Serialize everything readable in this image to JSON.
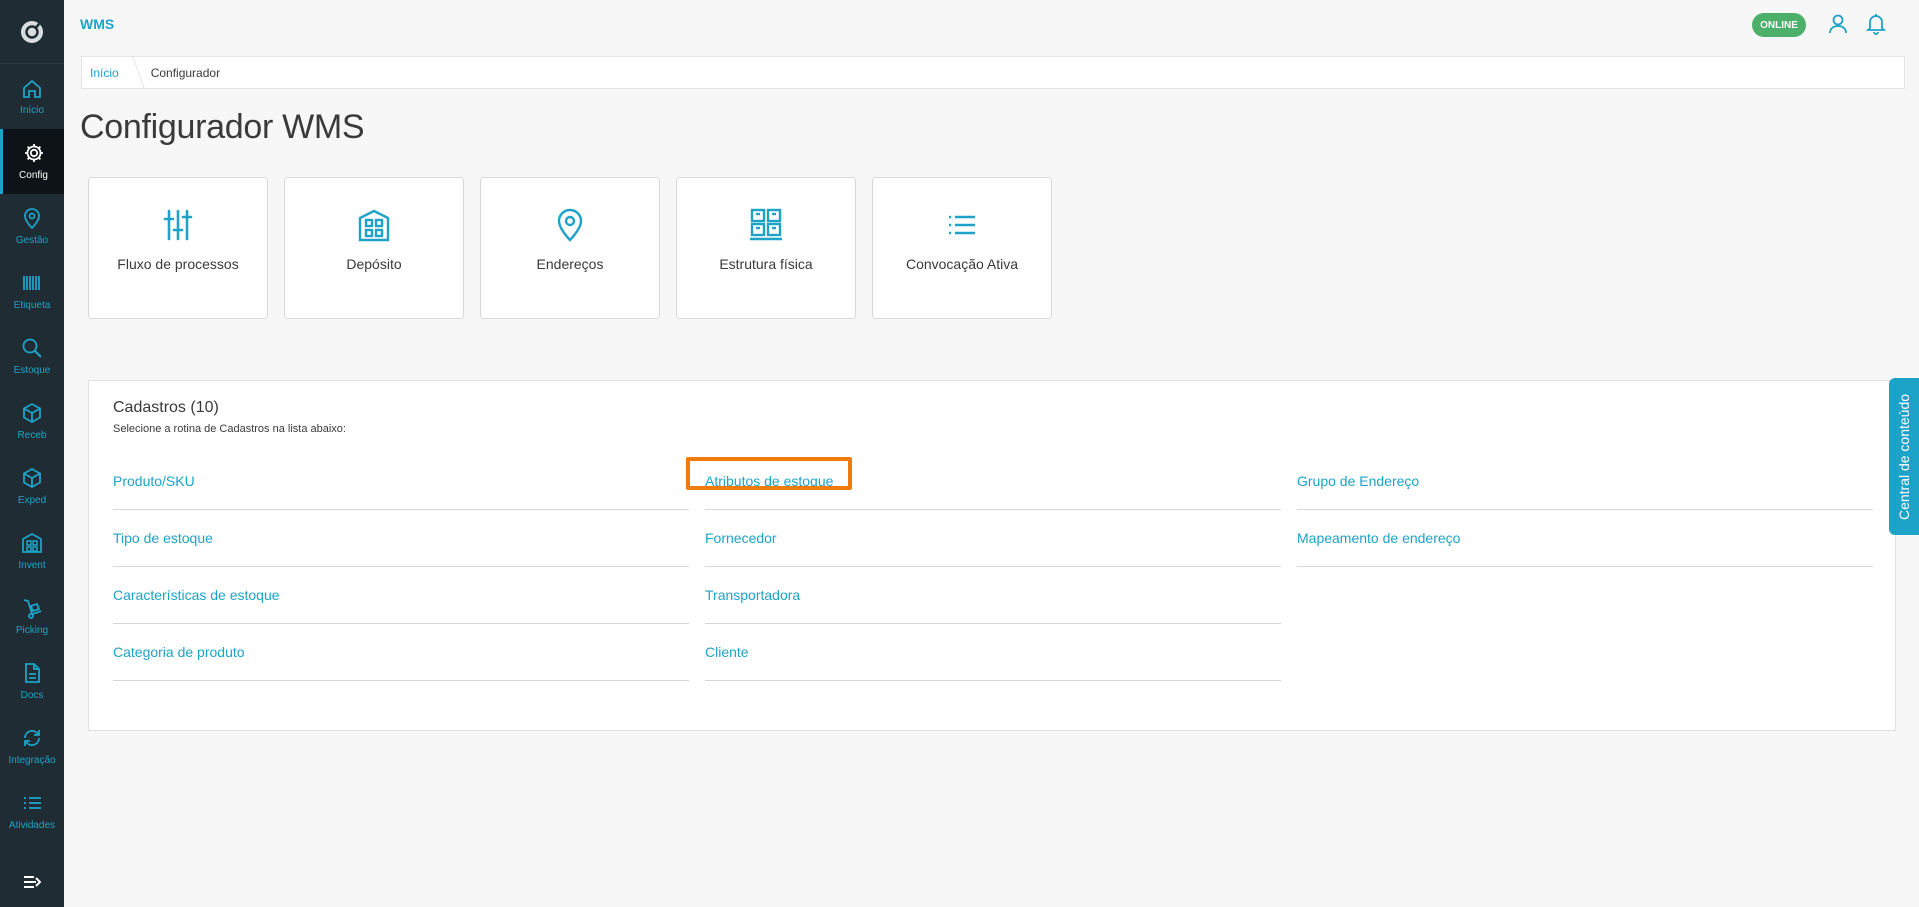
{
  "app": {
    "title": "WMS",
    "status": "ONLINE"
  },
  "colors": {
    "accent": "#1ea3c8",
    "sidebar": "#1f2c33",
    "online": "#4caf6a",
    "highlight": "#f07b0a"
  },
  "sidebar": {
    "items": [
      {
        "label": "Início",
        "icon": "home-icon"
      },
      {
        "label": "Config",
        "icon": "gear-icon"
      },
      {
        "label": "Gestão",
        "icon": "map-pin-icon"
      },
      {
        "label": "Etiqueta",
        "icon": "barcode-icon"
      },
      {
        "label": "Estoque",
        "icon": "search-icon"
      },
      {
        "label": "Receb",
        "icon": "box-icon"
      },
      {
        "label": "Exped",
        "icon": "box-icon"
      },
      {
        "label": "Invent",
        "icon": "building-icon"
      },
      {
        "label": "Picking",
        "icon": "hand-truck-icon"
      },
      {
        "label": "Docs",
        "icon": "document-icon"
      },
      {
        "label": "Integração",
        "icon": "sync-icon"
      },
      {
        "label": "Atividades",
        "icon": "list-icon"
      }
    ]
  },
  "breadcrumb": {
    "home": "Início",
    "current": "Configurador"
  },
  "page": {
    "title": "Configurador WMS"
  },
  "cards": [
    {
      "label": "Fluxo de processos",
      "icon": "sliders-icon"
    },
    {
      "label": "Depósito",
      "icon": "building-icon"
    },
    {
      "label": "Endereços",
      "icon": "map-pin-icon"
    },
    {
      "label": "Estrutura física",
      "icon": "pallet-icon"
    },
    {
      "label": "Convocação Ativa",
      "icon": "list-icon"
    }
  ],
  "cadastros": {
    "title": "Cadastros (10)",
    "subtitle": "Selecione a rotina de Cadastros na lista abaixo:",
    "columns": [
      [
        "Produto/SKU",
        "Tipo de estoque",
        "Características de estoque",
        "Categoria de produto"
      ],
      [
        "Atributos de estoque",
        "Fornecedor",
        "Transportadora",
        "Cliente"
      ],
      [
        "Grupo de Endereço",
        "Mapeamento de endereço"
      ]
    ],
    "highlighted": "Atributos de estoque"
  },
  "side_tab": {
    "label": "Central de conteúdo"
  }
}
